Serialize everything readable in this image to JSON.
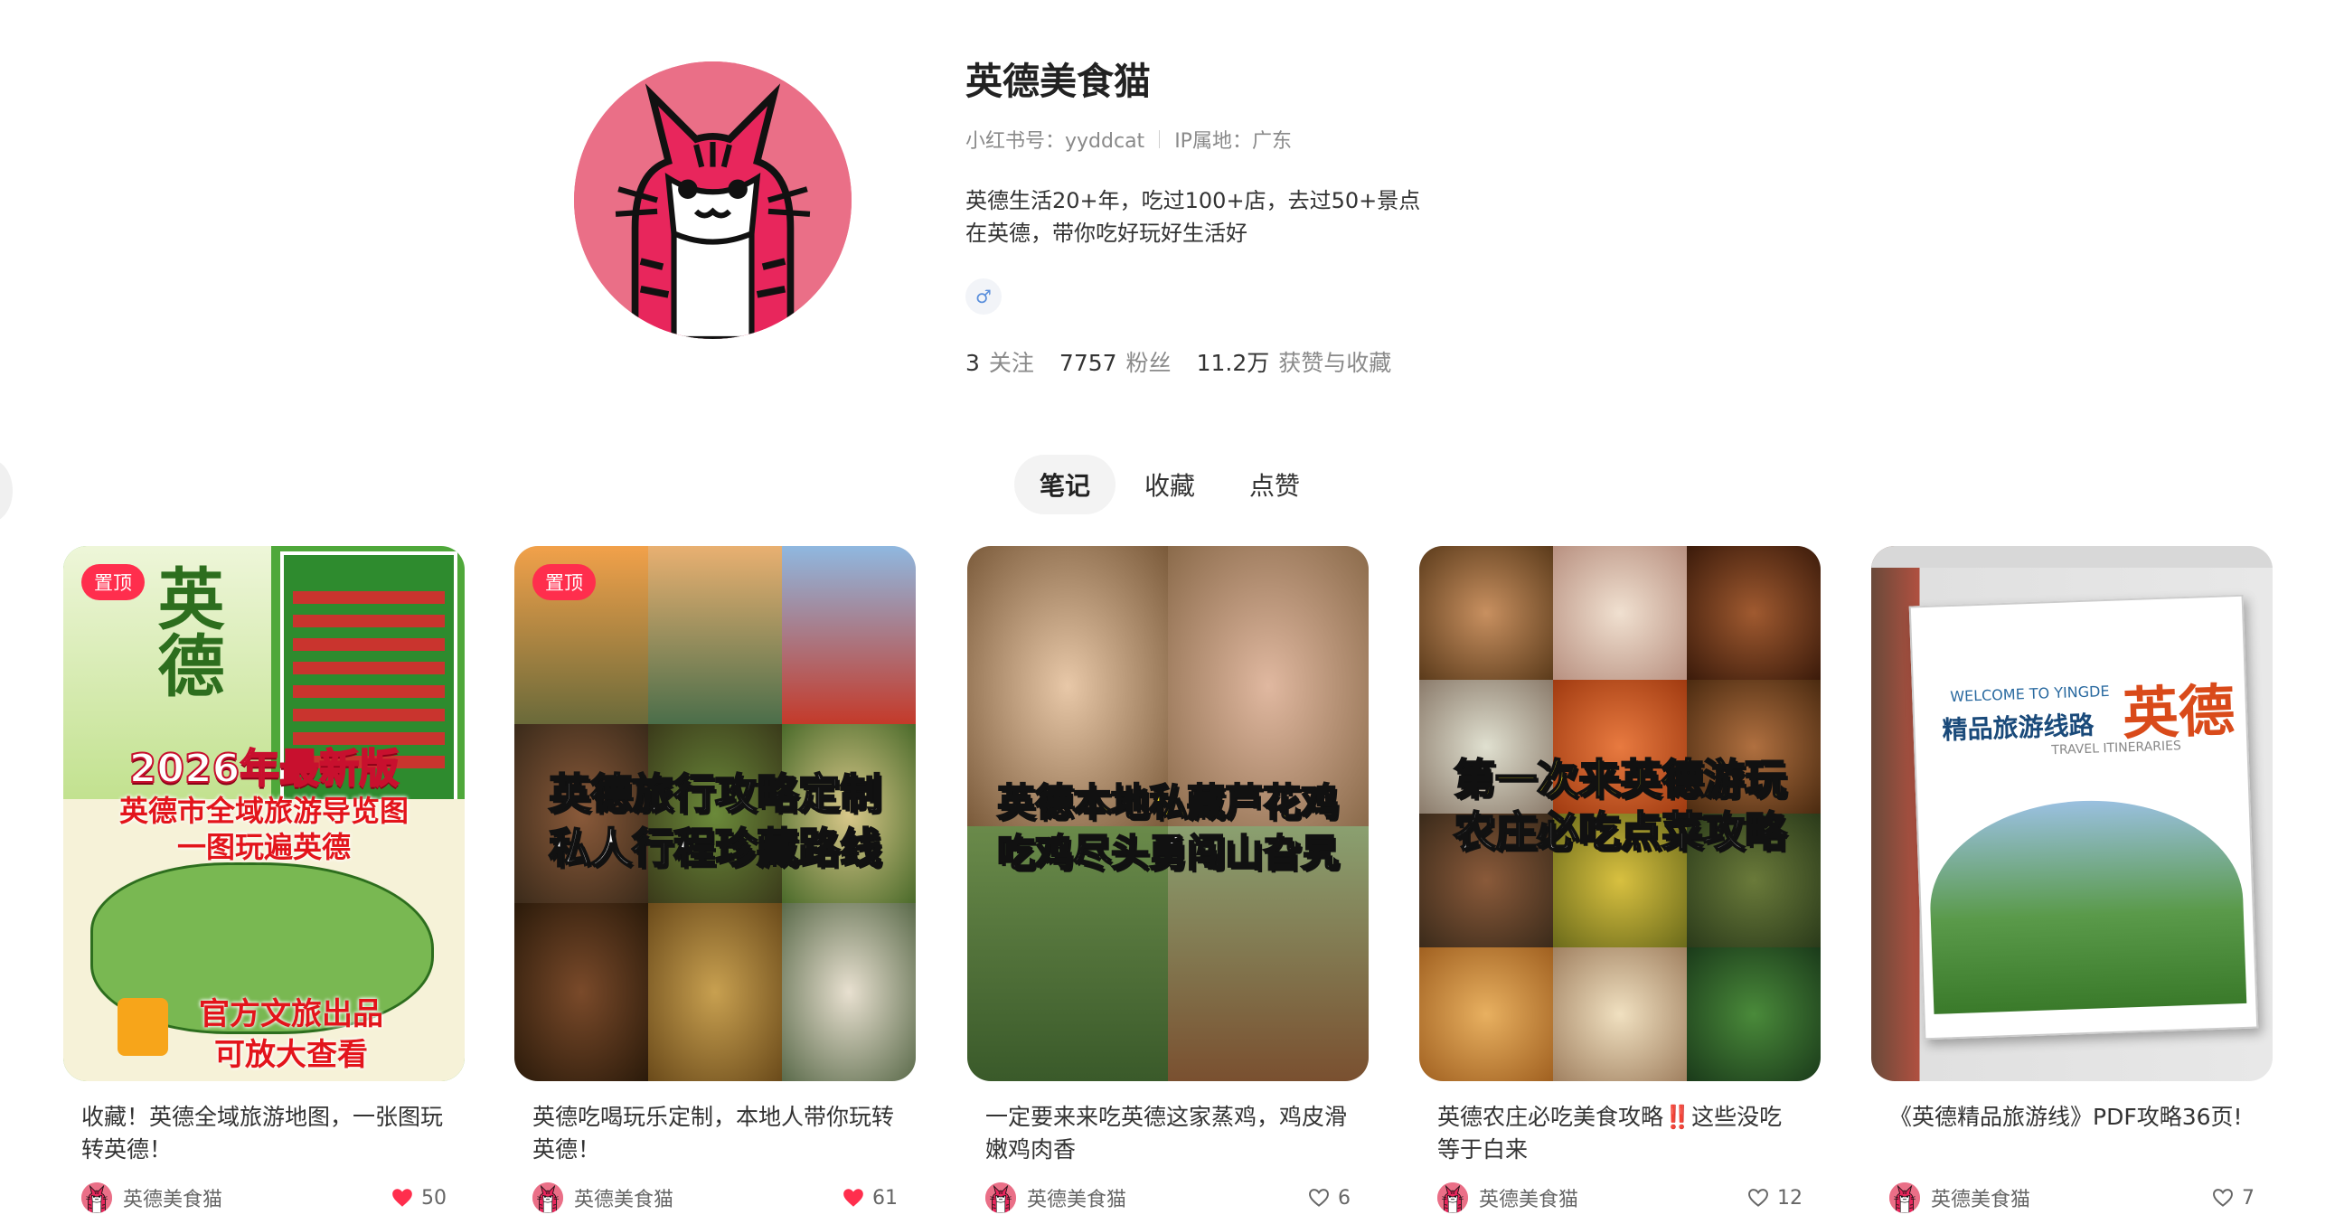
{
  "profile": {
    "nickname": "英德美食猫",
    "id_label": "小红书号：yyddcat",
    "ip_label": "IP属地：广东",
    "desc_line1": "英德生活20+年，吃过100+店，去过50+景点",
    "desc_line2": "在英德，带你吃好玩好生活好",
    "gender_icon": "♂",
    "stats": [
      {
        "num": "3",
        "label": "关注"
      },
      {
        "num": "7757",
        "label": "粉丝"
      },
      {
        "num": "11.2万",
        "label": "获赞与收藏"
      }
    ]
  },
  "tabs": [
    "笔记",
    "收藏",
    "点赞"
  ],
  "colors": {
    "accent": "#ff2e4d",
    "avatar_bg": "#ea6f87",
    "cat_pink": "#e8265c"
  },
  "notes": [
    {
      "pinned": "置顶",
      "cover_top": "2026年最新版",
      "cover_mid1": "英德市全域旅游导览图",
      "cover_mid2": "一图玩遍英德",
      "cover_bottom1": "官方文旅出品",
      "cover_bottom2": "可放大查看",
      "cover_badge": "英德",
      "title": "收藏！英德全域旅游地图，一张图玩转英德！",
      "author": "英德美食猫",
      "likes": "50",
      "liked": true
    },
    {
      "pinned": "置顶",
      "cover_line1": "英德旅行攻略定制",
      "cover_line2": "私人行程珍藏路线",
      "title": "英德吃喝玩乐定制，本地人带你玩转英德！",
      "author": "英德美食猫",
      "likes": "61",
      "liked": true
    },
    {
      "cover_line1": "英德本地私藏芦花鸡",
      "cover_line2": "吃鸡尽头勇闯山旮旯",
      "title": "一定要来来吃英德这家蒸鸡，鸡皮滑嫩鸡肉香",
      "author": "英德美食猫",
      "likes": "6",
      "liked": false
    },
    {
      "cover_line1": "第一次来英德游玩",
      "cover_line2": "农庄必吃点菜攻略",
      "title": "英德农庄必吃美食攻略‼️这些没吃等于白来",
      "author": "英德美食猫",
      "likes": "12",
      "liked": false
    },
    {
      "cover_sub": "精品旅游线路",
      "cover_big": "英德",
      "cover_welcome": "WELCOME TO YINGDE",
      "cover_travel": "TRAVEL ITINERARIES",
      "title": "《英德精品旅游线》PDF攻略36页!",
      "author": "英德美食猫",
      "likes": "7",
      "liked": false
    }
  ]
}
